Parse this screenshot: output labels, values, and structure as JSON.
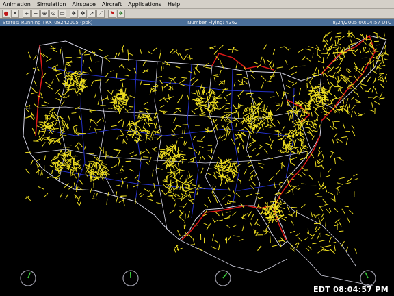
{
  "menu": [
    "Animation",
    "Simulation",
    "Airspace",
    "Aircraft",
    "Applications",
    "Help"
  ],
  "toolbar": {
    "buttons": [
      {
        "name": "record-button",
        "glyph": "●",
        "color": "#c01818"
      },
      {
        "name": "pause-button",
        "glyph": "⏸",
        "color": "#222222"
      },
      {
        "name": "zoom-in-button",
        "glyph": "+",
        "color": "#222222"
      },
      {
        "name": "zoom-out-button",
        "glyph": "−",
        "color": "#222222"
      },
      {
        "name": "zoom-area-button",
        "glyph": "⊕",
        "color": "#222222"
      },
      {
        "name": "zoom-reset-button",
        "glyph": "⊙",
        "color": "#222222"
      },
      {
        "name": "select-button",
        "glyph": "▭",
        "color": "#222222"
      },
      {
        "name": "aircraft-button",
        "glyph": "✈",
        "color": "#222222"
      },
      {
        "name": "pan-button",
        "glyph": "✥",
        "color": "#222222"
      },
      {
        "name": "route-button",
        "glyph": "↗",
        "color": "#222222"
      },
      {
        "name": "measure-button",
        "glyph": "⟋",
        "color": "#222222"
      },
      {
        "name": "flag-button",
        "glyph": "⚑",
        "color": "#c01818"
      },
      {
        "name": "filter-button",
        "glyph": "✈",
        "color": "#227722"
      }
    ]
  },
  "status": {
    "text": "Status: Running TRX_08242005 (pbk)",
    "number_flying": "Number Flying: 4362",
    "datetime": "8/24/2005 00:04:57 UTC"
  },
  "clock": "EDT 08:04:57 PM",
  "colors": {
    "aircraft": "#f0e020",
    "coast": "#d81818",
    "center_boundary": "#2430c8",
    "sector_boundary": "#d8d8e8",
    "background": "#000000"
  }
}
